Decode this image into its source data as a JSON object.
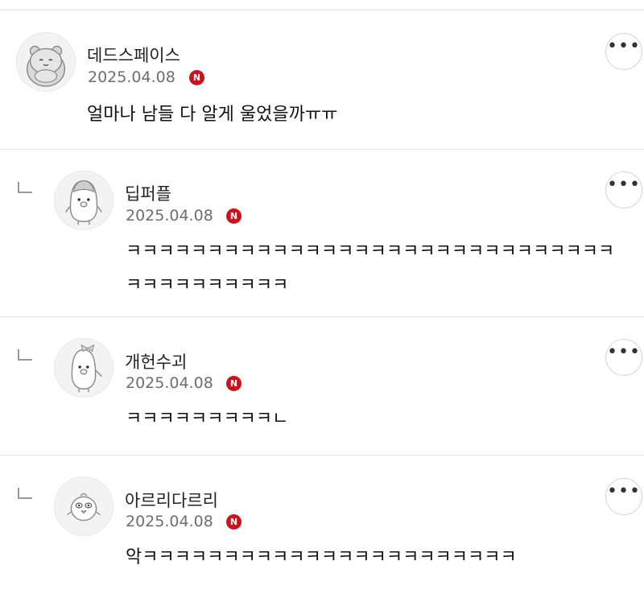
{
  "comments": [
    {
      "username": "데드스페이스",
      "date": "2025.04.08",
      "badge": "N",
      "text": "얼마나 남들 다 알게 울었을까ㅠㅠ",
      "avatar_icon": "hamster-avatar-icon",
      "is_reply": false
    },
    {
      "username": "딥퍼플",
      "date": "2025.04.08",
      "badge": "N",
      "text": "ㅋㅋㅋㅋㅋㅋㅋㅋㅋㅋㅋㅋㅋㅋㅋㅋㅋㅋㅋㅋㅋㅋㅋㅋㅋㅋㅋㅋㅋㅋㅋㅋㅋㅋㅋㅋㅋㅋㅋㅋ",
      "avatar_icon": "penguin-avatar-icon",
      "is_reply": true
    },
    {
      "username": "개헌수괴",
      "date": "2025.04.08",
      "badge": "N",
      "text": "ㅋㅋㅋㅋㅋㅋㅋㅋㅋㄴ",
      "avatar_icon": "penguin-bow-avatar-icon",
      "is_reply": true
    },
    {
      "username": "아르리다르리",
      "date": "2025.04.08",
      "badge": "N",
      "text": "악ㅋㅋㅋㅋㅋㅋㅋㅋㅋㅋㅋㅋㅋㅋㅋㅋㅋㅋㅋㅋㅋㅋㅋ",
      "avatar_icon": "chick-avatar-icon",
      "is_reply": true
    }
  ],
  "more_button_label": "•••",
  "colors": {
    "badge": "#c8141e",
    "divider": "#e3e3e3",
    "date": "#6e6e6e"
  }
}
